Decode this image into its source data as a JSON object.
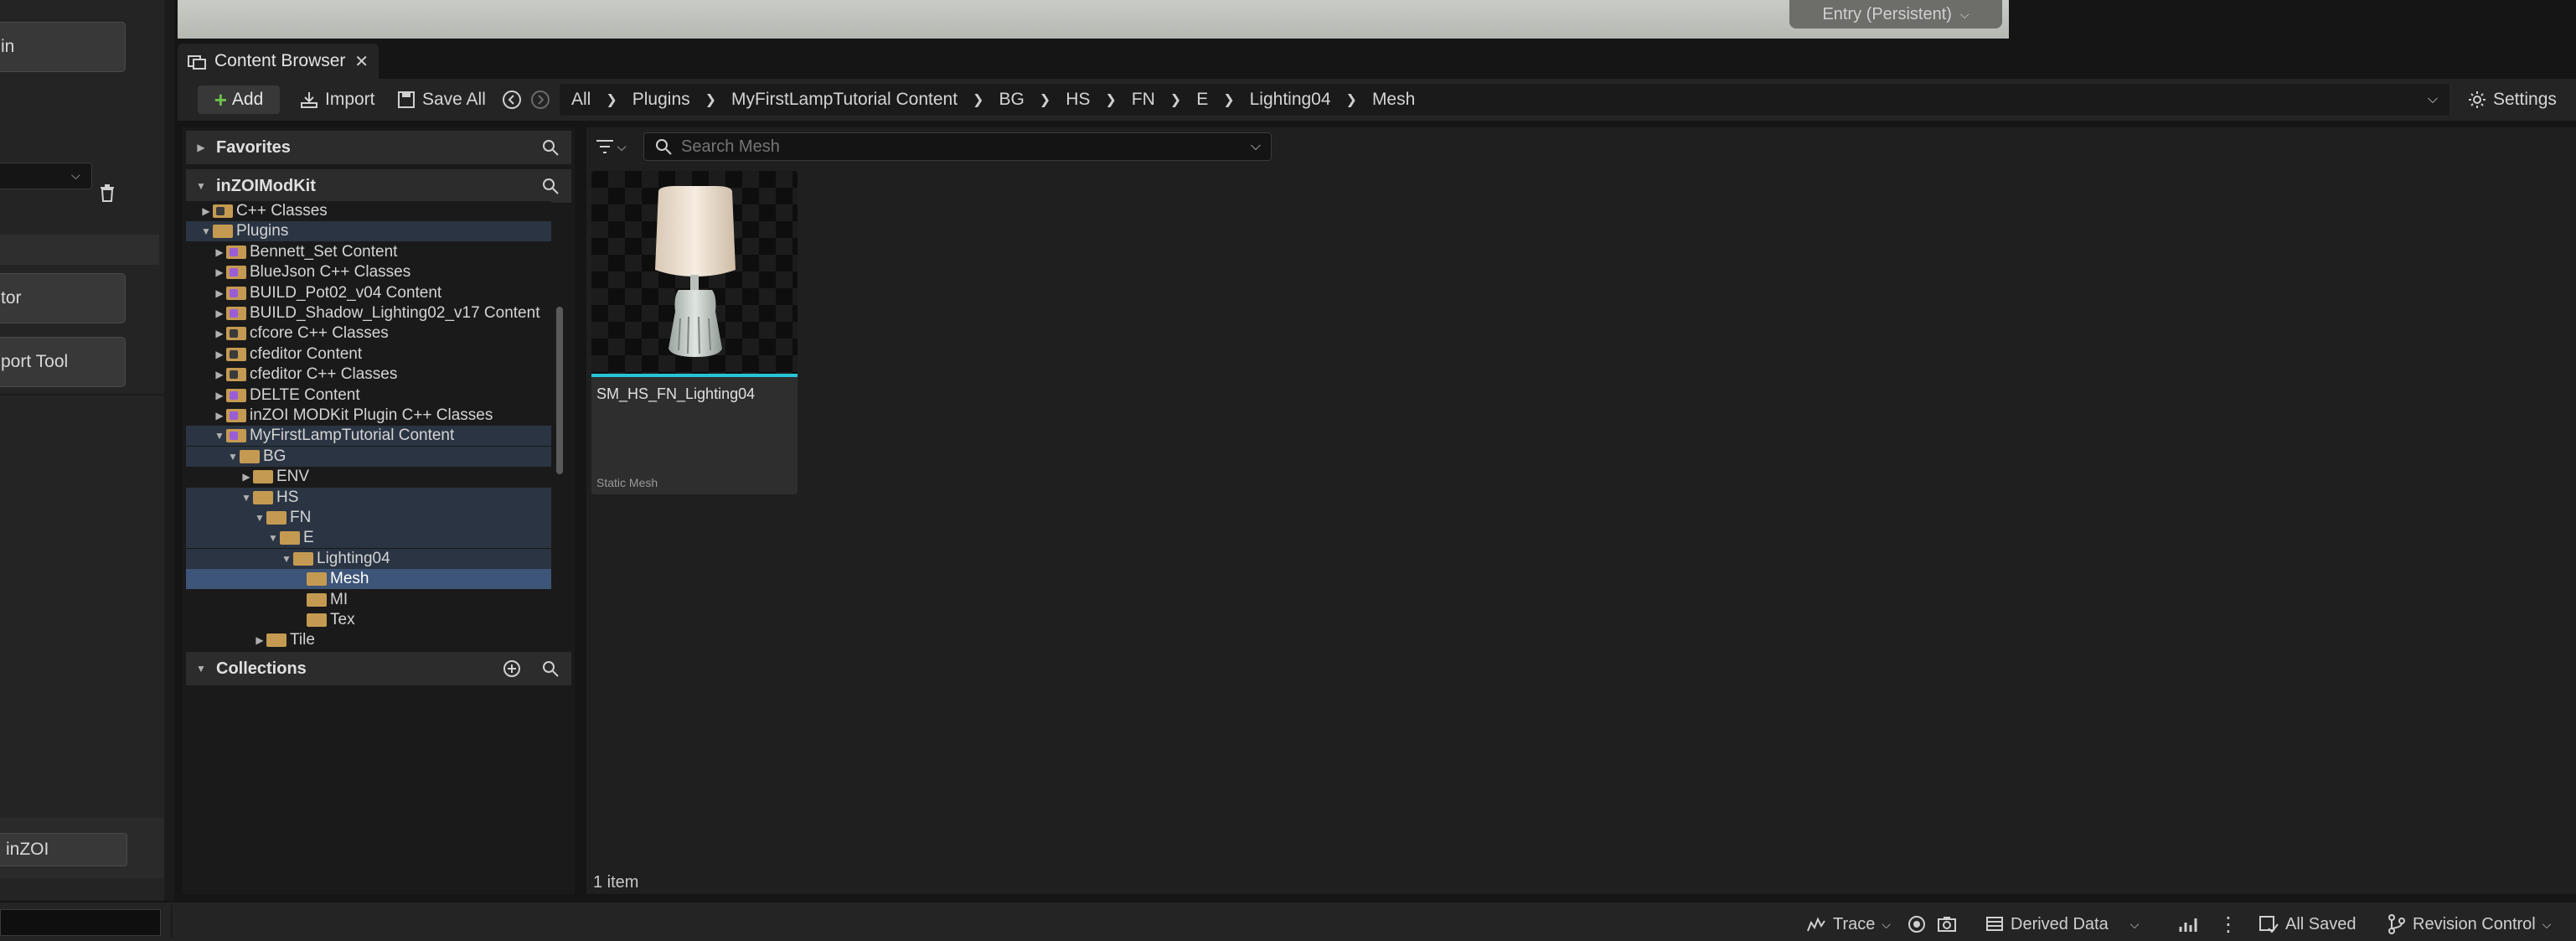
{
  "left_panel": {
    "button_top": "in",
    "button_mid": "tor",
    "button_bottom": "port Tool",
    "button_footer": "inZOI"
  },
  "viewport": {
    "level_dropdown": "Entry (Persistent)"
  },
  "content_browser": {
    "tab_title": "Content Browser",
    "toolbar": {
      "add": "Add",
      "import": "Import",
      "save_all": "Save All",
      "settings": "Settings"
    },
    "breadcrumb": [
      "All",
      "Plugins",
      "MyFirstLampTutorial Content",
      "BG",
      "HS",
      "FN",
      "E",
      "Lighting04",
      "Mesh"
    ],
    "sources": {
      "favorites": "Favorites",
      "project": "inZOIModKit",
      "collections": "Collections",
      "tree": [
        {
          "label": "C++ Classes",
          "indent": 1,
          "state": "collapsed",
          "icon": "cpp"
        },
        {
          "label": "Plugins",
          "indent": 1,
          "state": "expanded",
          "icon": "open",
          "hl": true
        },
        {
          "label": "Bennett_Set Content",
          "indent": 2,
          "state": "collapsed",
          "icon": "purple"
        },
        {
          "label": "BlueJson C++ Classes",
          "indent": 2,
          "state": "collapsed",
          "icon": "purple"
        },
        {
          "label": "BUILD_Pot02_v04 Content",
          "indent": 2,
          "state": "collapsed",
          "icon": "purple"
        },
        {
          "label": "BUILD_Shadow_Lighting02_v17 Content",
          "indent": 2,
          "state": "collapsed",
          "icon": "purple"
        },
        {
          "label": "cfcore C++ Classes",
          "indent": 2,
          "state": "collapsed",
          "icon": "cpp"
        },
        {
          "label": "cfeditor Content",
          "indent": 2,
          "state": "collapsed",
          "icon": "cpp"
        },
        {
          "label": "cfeditor C++ Classes",
          "indent": 2,
          "state": "collapsed",
          "icon": "cpp"
        },
        {
          "label": "DELTE Content",
          "indent": 2,
          "state": "collapsed",
          "icon": "purple"
        },
        {
          "label": "inZOI MODKit Plugin C++ Classes",
          "indent": 2,
          "state": "collapsed",
          "icon": "purple"
        },
        {
          "label": "MyFirstLampTutorial Content",
          "indent": 2,
          "state": "expanded",
          "icon": "purple",
          "hl": true
        },
        {
          "label": "BG",
          "indent": 3,
          "state": "expanded",
          "icon": "open",
          "hl": true
        },
        {
          "label": "ENV",
          "indent": 4,
          "state": "collapsed",
          "icon": "plain"
        },
        {
          "label": "HS",
          "indent": 4,
          "state": "expanded",
          "icon": "open",
          "hl": true
        },
        {
          "label": "FN",
          "indent": 5,
          "state": "expanded",
          "icon": "open",
          "hl": true
        },
        {
          "label": "E",
          "indent": 6,
          "state": "expanded",
          "icon": "open",
          "hl": true
        },
        {
          "label": "Lighting04",
          "indent": 7,
          "state": "expanded",
          "icon": "open",
          "hl": true
        },
        {
          "label": "Mesh",
          "indent": 8,
          "state": "none",
          "icon": "plain",
          "sel": true
        },
        {
          "label": "MI",
          "indent": 8,
          "state": "none",
          "icon": "plain"
        },
        {
          "label": "Tex",
          "indent": 8,
          "state": "none",
          "icon": "plain"
        },
        {
          "label": "Tile",
          "indent": 5,
          "state": "collapsed",
          "icon": "plain"
        }
      ]
    },
    "search_placeholder": "Search Mesh",
    "assets": [
      {
        "name": "SM_HS_FN_Lighting04",
        "type": "Static Mesh"
      }
    ],
    "item_count": "1 item"
  },
  "status_bar": {
    "trace": "Trace",
    "derived_data": "Derived Data",
    "all_saved": "All Saved",
    "revision_control": "Revision Control"
  }
}
